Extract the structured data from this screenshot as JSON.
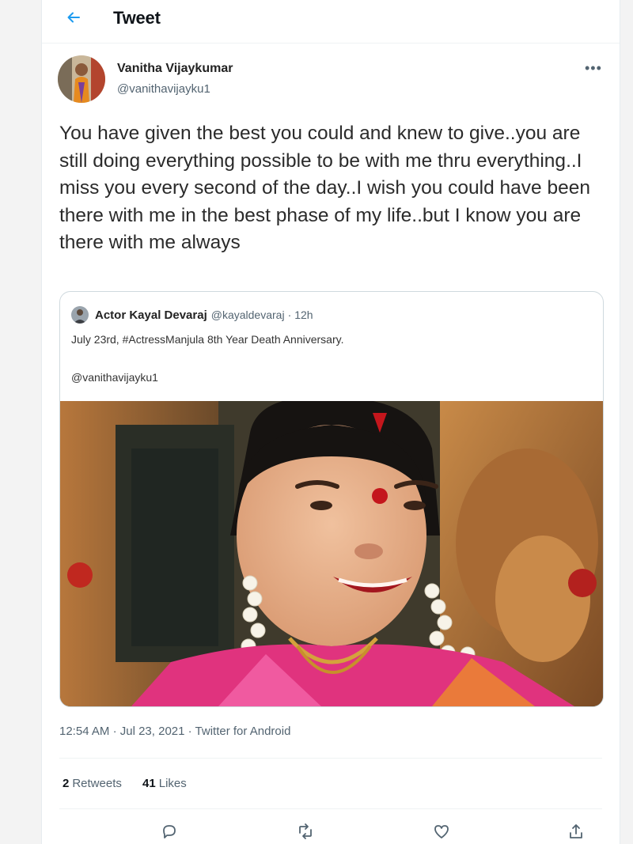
{
  "header": {
    "title": "Tweet",
    "back_icon": "arrow-left-icon",
    "accent_color": "#1d9bf0"
  },
  "tweet": {
    "author": {
      "name": "Vanitha Vijaykumar",
      "handle": "@vanithavijayku1",
      "avatar_icon": "profile-photo"
    },
    "more_icon": "more-horizontal-icon",
    "text": "You have given the best you could and knew to give..you are still doing everything possible to be with me thru everything..I miss you every second of the day..I wish you could have been there with me in the best phase of my life..but I know you are there with me always",
    "quoted": {
      "name": "Actor Kayal Devaraj",
      "handle": "@kayaldevaraj",
      "separator": "·",
      "time": "12h",
      "line1": "July 23rd, #ActressManjula 8th Year Death Anniversary.",
      "line2": "@vanithavijayku1",
      "photo": "portrait-photo"
    },
    "meta": {
      "time": "12:54 AM",
      "separator": "·",
      "date": "Jul 23, 2021",
      "source": "Twitter for Android"
    },
    "stats": {
      "retweets_count": "2",
      "retweets_label": "Retweets",
      "likes_count": "41",
      "likes_label": "Likes"
    },
    "actions": [
      "reply-icon",
      "retweet-icon",
      "like-icon",
      "share-icon"
    ]
  },
  "colors": {
    "text_primary": "#0f1419",
    "text_secondary": "#536471",
    "border": "#cfd9de"
  }
}
